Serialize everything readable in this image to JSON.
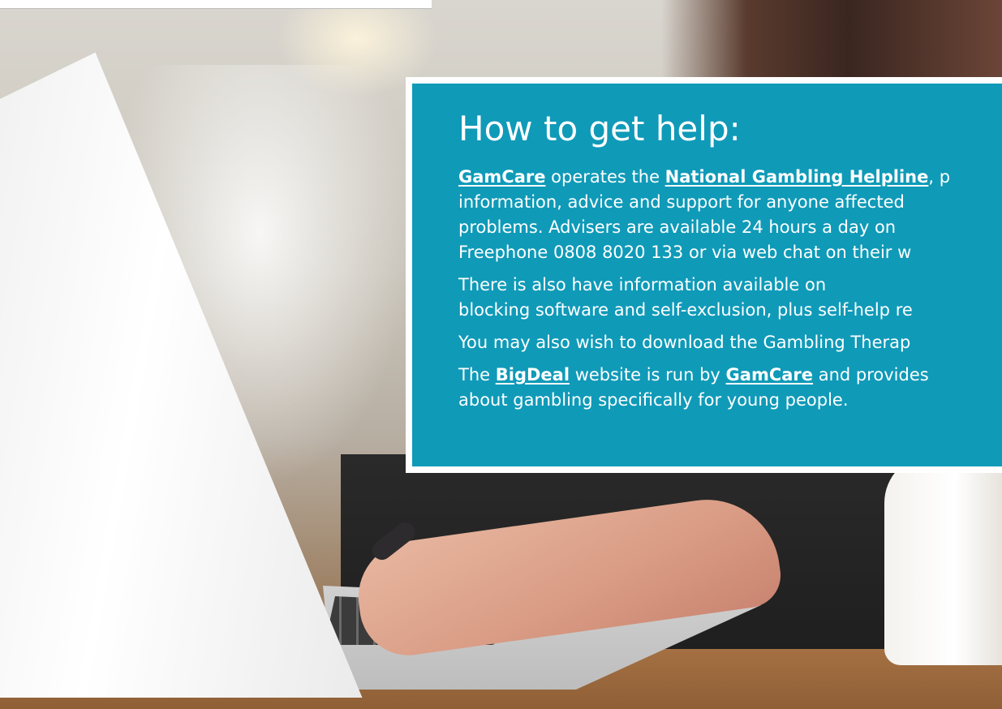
{
  "help_panel": {
    "title": "How to get help:",
    "paragraph1": {
      "link_gamcare": "GamCare",
      "text_operates": " operates the ",
      "link_helpline": "National Gambling Helpline",
      "text_after_helpline": ", p",
      "line2": "information, advice and support for anyone affected",
      "line3": "problems. Advisers are available 24 hours a day on",
      "line4": "Freephone 0808 8020 133 or via web chat on their w"
    },
    "paragraph2": {
      "line1": "There is also have information available on",
      "line2": "blocking software and self-exclusion, plus self-help re"
    },
    "paragraph3": {
      "line1": "You may also wish to download the Gambling Therap"
    },
    "paragraph4": {
      "text_the": "The ",
      "link_bigdeal": "BigDeal",
      "text_run_by": " website is run by ",
      "link_gamcare": "GamCare",
      "text_after": " and provides",
      "line2": "about gambling specifically for young people."
    }
  },
  "colors": {
    "panel_background": "#0f9ab8",
    "panel_text": "#ffffff",
    "frame": "#ffffff"
  }
}
